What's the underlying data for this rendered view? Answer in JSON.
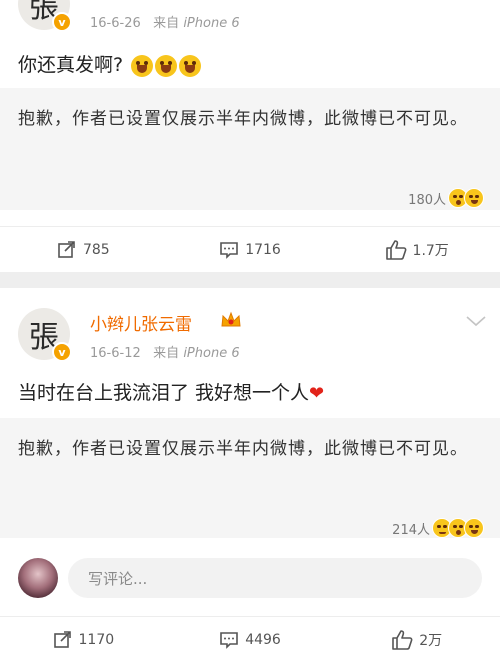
{
  "post1": {
    "time": "16-6-26",
    "source_prefix": "来自",
    "source": "iPhone 6",
    "text": "你还真发啊?",
    "repost_text": "抱歉，作者已设置仅展示半年内微博，此微博已不可见。",
    "likes_label": "180人",
    "actions": {
      "repost": "785",
      "comments": "1716",
      "likes": "1.7万"
    }
  },
  "post2": {
    "username": "小辫儿张云雷",
    "time": "16-6-12",
    "source_prefix": "来自",
    "source": "iPhone 6",
    "text": "当时在台上我流泪了 我好想一个人",
    "repost_text": "抱歉，作者已设置仅展示半年内微博，此微博已不可见。",
    "likes_label": "214人",
    "comment_placeholder": "写评论...",
    "actions": {
      "repost": "1170",
      "comments": "4496",
      "likes": "2万"
    }
  },
  "avatar_char": "張",
  "colors": {
    "username": "#f06b00",
    "verified": "#f5a200",
    "background": "#eeeeee"
  },
  "icons": [
    "share-icon",
    "comment-icon",
    "thumbs-up-icon",
    "chevron-down-icon",
    "crown-icon",
    "verified-badge-icon"
  ]
}
